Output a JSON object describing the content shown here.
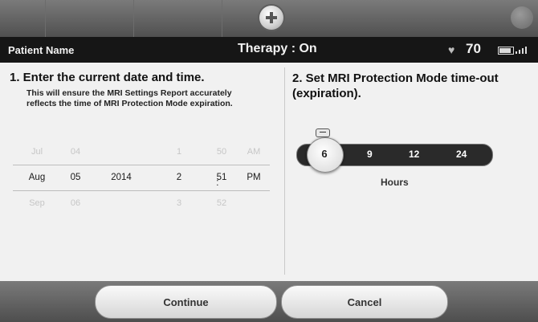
{
  "status": {
    "patient_name": "Patient Name",
    "therapy": "Therapy : On",
    "heart_rate": "70"
  },
  "step1": {
    "title": "1. Enter the current date and time.",
    "note": "This will ensure the MRI Settings Report accurately reflects the time of MRI Protection Mode expiration.",
    "picker": {
      "month": [
        "Jul",
        "Aug",
        "Sep"
      ],
      "day": [
        "04",
        "05",
        "06"
      ],
      "year": [
        "",
        "2014",
        ""
      ],
      "hour": [
        "1",
        "2",
        "3"
      ],
      "minute": [
        "50",
        "51",
        "52"
      ],
      "ampm": [
        "AM",
        "PM",
        ""
      ],
      "separator": ":"
    }
  },
  "step2": {
    "title": "2. Set MRI Protection Mode time-out (expiration).",
    "options": [
      "6",
      "9",
      "12",
      "24"
    ],
    "selected": "6",
    "unit_label": "Hours"
  },
  "buttons": {
    "continue": "Continue",
    "cancel": "Cancel"
  },
  "icons": {
    "add": "plus-icon",
    "logo": "manufacturer-logo-icon",
    "heart": "heart-icon",
    "battery": "battery-icon",
    "telemetry": "telemetry-signal-icon"
  }
}
